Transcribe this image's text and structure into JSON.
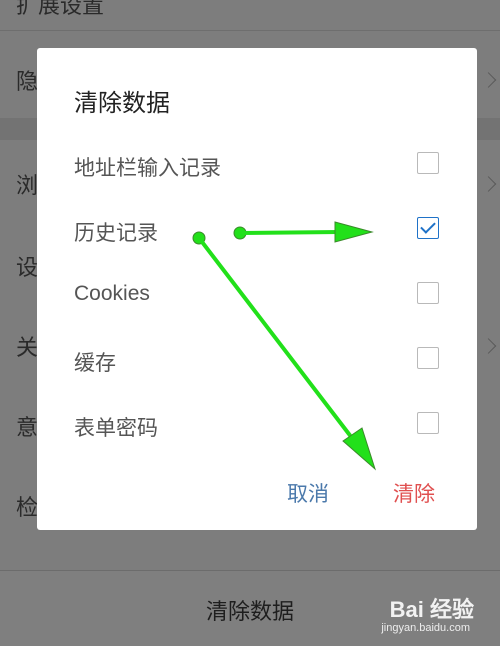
{
  "background": {
    "top_partial_label": "扩展设置",
    "rows": [
      "隐",
      "浏",
      "设",
      "关",
      "意",
      "检"
    ],
    "bottom_action": "清除数据"
  },
  "dialog": {
    "title": "清除数据",
    "options": [
      {
        "label": "地址栏输入记录",
        "checked": false
      },
      {
        "label": "历史记录",
        "checked": true
      },
      {
        "label": "Cookies",
        "checked": false
      },
      {
        "label": "缓存",
        "checked": false
      },
      {
        "label": "表单密码",
        "checked": false
      }
    ],
    "cancel_label": "取消",
    "clear_label": "清除"
  },
  "colors": {
    "accent": "#1f72c8",
    "danger": "#e05050",
    "cancel": "#4b79ab",
    "annotation": "#22e01a"
  },
  "watermark": {
    "brand": "Bai 经验",
    "url": "jingyan.baidu.com"
  }
}
